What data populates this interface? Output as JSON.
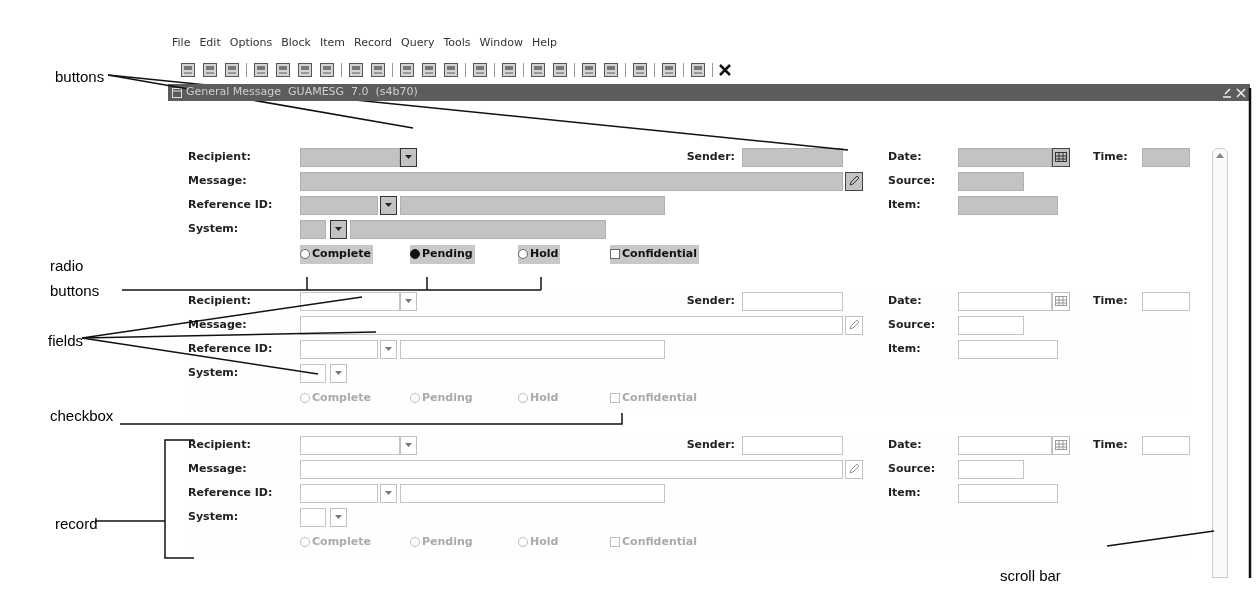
{
  "menu": [
    "File",
    "Edit",
    "Options",
    "Block",
    "Item",
    "Record",
    "Query",
    "Tools",
    "Window",
    "Help"
  ],
  "window": {
    "title": "General Message  GUAMESG  7.0  (s4b70)"
  },
  "records": [
    {
      "current": true,
      "labels": {
        "recipient": "Recipient:",
        "sender": "Sender:",
        "message": "Message:",
        "reference_id": "Reference ID:",
        "system": "System:",
        "date": "Date:",
        "time": "Time:",
        "source": "Source:",
        "item": "Item:"
      },
      "options": [
        {
          "kind": "radio",
          "label": "Complete",
          "selected": false
        },
        {
          "kind": "radio",
          "label": "Pending",
          "selected": true
        },
        {
          "kind": "radio",
          "label": "Hold",
          "selected": false
        },
        {
          "kind": "checkbox",
          "label": "Confidential",
          "checked": false
        }
      ]
    },
    {
      "current": false,
      "labels": {
        "recipient": "Recipient:",
        "sender": "Sender:",
        "message": "Message:",
        "reference_id": "Reference ID:",
        "system": "System:",
        "date": "Date:",
        "time": "Time:",
        "source": "Source:",
        "item": "Item:"
      },
      "options": [
        {
          "kind": "radio",
          "label": "Complete",
          "selected": false
        },
        {
          "kind": "radio",
          "label": "Pending",
          "selected": false
        },
        {
          "kind": "radio",
          "label": "Hold",
          "selected": false
        },
        {
          "kind": "checkbox",
          "label": "Confidential",
          "checked": false
        }
      ]
    },
    {
      "current": false,
      "labels": {
        "recipient": "Recipient:",
        "sender": "Sender:",
        "message": "Message:",
        "reference_id": "Reference ID:",
        "system": "System:",
        "date": "Date:",
        "time": "Time:",
        "source": "Source:",
        "item": "Item:"
      },
      "options": [
        {
          "kind": "radio",
          "label": "Complete",
          "selected": false
        },
        {
          "kind": "radio",
          "label": "Pending",
          "selected": false
        },
        {
          "kind": "radio",
          "label": "Hold",
          "selected": false
        },
        {
          "kind": "checkbox",
          "label": "Confidential",
          "checked": false
        }
      ]
    }
  ],
  "callouts": [
    {
      "text": "buttons"
    },
    {
      "text": "radio\nbuttons"
    },
    {
      "text": "fields"
    },
    {
      "text": "checkbox"
    },
    {
      "text": "record"
    },
    {
      "text": "scroll bar"
    }
  ]
}
